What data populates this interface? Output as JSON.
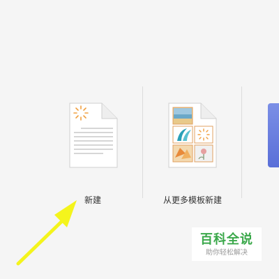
{
  "tiles": [
    {
      "label": "新建",
      "icon": "blank-document-icon"
    },
    {
      "label": "从更多模板新建",
      "icon": "template-document-icon"
    }
  ],
  "watermark": {
    "title": "百科全说",
    "subtitle": "助你轻松解决"
  },
  "colors": {
    "background": "#f5f5f5",
    "sun_orange": "#f0a040",
    "watermark_green": "#3aa84a",
    "arrow_yellow": "#f4f41c",
    "next_tile_blue": "#6a7ee0"
  }
}
